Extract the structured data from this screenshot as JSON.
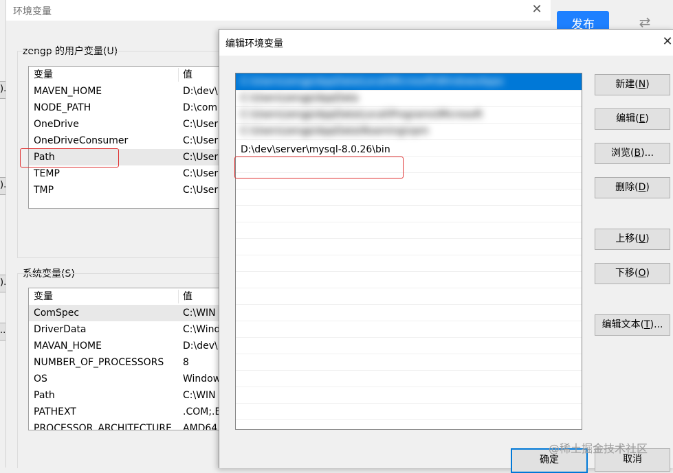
{
  "env_window": {
    "title": "环境变量",
    "close_icon": "✕",
    "user_group_label": "zengp 的用户变量(U)",
    "system_group_label": "系统变量(S)",
    "columns": {
      "name": "变量",
      "value": "值"
    },
    "user_vars": [
      {
        "name": "MAVEN_HOME",
        "value": "D:\\dev\\"
      },
      {
        "name": "NODE_PATH",
        "value": "D:\\com"
      },
      {
        "name": "OneDrive",
        "value": "C:\\User"
      },
      {
        "name": "OneDriveConsumer",
        "value": "C:\\User"
      },
      {
        "name": "Path",
        "value": "C:\\User"
      },
      {
        "name": "TEMP",
        "value": "C:\\User"
      },
      {
        "name": "TMP",
        "value": "C:\\User"
      }
    ],
    "system_vars": [
      {
        "name": "ComSpec",
        "value": "C:\\WIN"
      },
      {
        "name": "DriverData",
        "value": "C:\\Wind"
      },
      {
        "name": "MAVAN_HOME",
        "value": "D:\\dev\\"
      },
      {
        "name": "NUMBER_OF_PROCESSORS",
        "value": "8"
      },
      {
        "name": "OS",
        "value": "Window"
      },
      {
        "name": "Path",
        "value": "C:\\WIN"
      },
      {
        "name": "PATHEXT",
        "value": ".COM;.E"
      },
      {
        "name": "PROCESSOR_ARCHITECTURE",
        "value": "AMD64"
      }
    ]
  },
  "topbar": {
    "publish_label": "发布",
    "swap_icon": "⇄"
  },
  "edit_dialog": {
    "title": "编辑环境变量",
    "close_icon": "✕",
    "path_entries": [
      {
        "text": "C:\\Users\\zengp\\AppData\\Local\\Microsoft\\WindowsApps",
        "blurred": true
      },
      {
        "text": "C:\\Users\\zengp\\AppData",
        "blurred": true
      },
      {
        "text": "C:\\Users\\zengp\\AppData\\Local\\Programs\\Microsoft",
        "blurred": true
      },
      {
        "text": "C:\\Users\\zengp\\AppData\\Roaming\\npm",
        "blurred": true
      },
      {
        "text": "D:\\dev\\server\\mysql-8.0.26\\bin",
        "blurred": false
      }
    ],
    "buttons": {
      "new": {
        "label": "新建(",
        "key": "N",
        "end": ")"
      },
      "edit": {
        "label": "编辑(",
        "key": "E",
        "end": ")"
      },
      "browse": {
        "label": "浏览(",
        "key": "B",
        "end": ")..."
      },
      "delete": {
        "label": "删除(",
        "key": "D",
        "end": ")"
      },
      "up": {
        "label": "上移(",
        "key": "U",
        "end": ")"
      },
      "down": {
        "label": "下移(",
        "key": "O",
        "end": ")"
      },
      "edit_text": {
        "label": "编辑文本(",
        "key": "T",
        "end": ")..."
      }
    },
    "ok_label": "确定",
    "cancel_label": "取消"
  },
  "watermark": "@稀土掘金技术社区",
  "edge_buttons": [
    ").",
    ").",
    ").",
    "..."
  ]
}
